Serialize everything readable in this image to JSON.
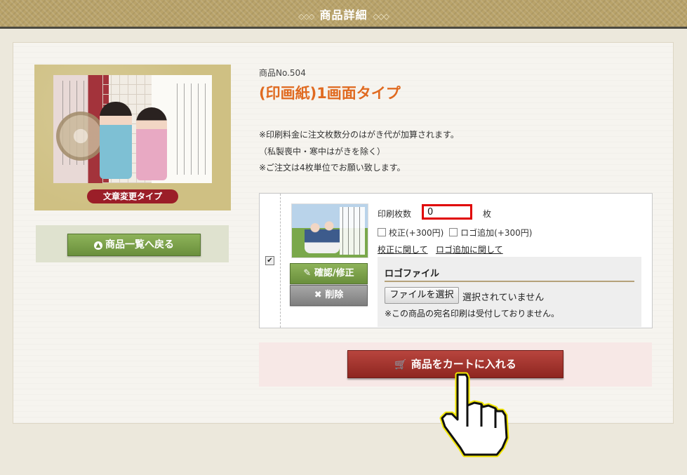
{
  "header": {
    "title": "商品詳細",
    "ornament_left": "◇◇◇",
    "ornament_right": "◇◇◇"
  },
  "product": {
    "image_badge": "文章変更タイプ",
    "number": "商品No.504",
    "title": "(印画紙)1画面タイプ",
    "notes": [
      "※印刷料金に注文枚数分のはがき代が加算されます。",
      "（私製喪中・寒中はがきを除く）",
      "※ご注文は4枚単位でお願い致します。"
    ]
  },
  "back_button": {
    "label": "商品一覧へ戻る"
  },
  "option": {
    "checked": true,
    "confirm_label": "確認/修正",
    "delete_label": "削除",
    "print_count_label": "印刷枚数",
    "print_count_value": "0",
    "unit": "枚",
    "proof_label": "校正(+300円)",
    "logo_add_label": "ロゴ追加(+300円)",
    "proof_link": "校正に関して",
    "logo_link": "ロゴ追加に関して"
  },
  "logo_file": {
    "heading": "ロゴファイル",
    "choose_button": "ファイルを選択",
    "no_file_text": "選択されていません",
    "note": "※この商品の宛名印刷は受付しておりません。"
  },
  "cart_button": {
    "label": "商品をカートに入れる"
  },
  "colors": {
    "accent_orange": "#e06a20",
    "cart_red": "#9e2e26",
    "green": "#6a8f3c",
    "highlight_red": "#e00000"
  }
}
